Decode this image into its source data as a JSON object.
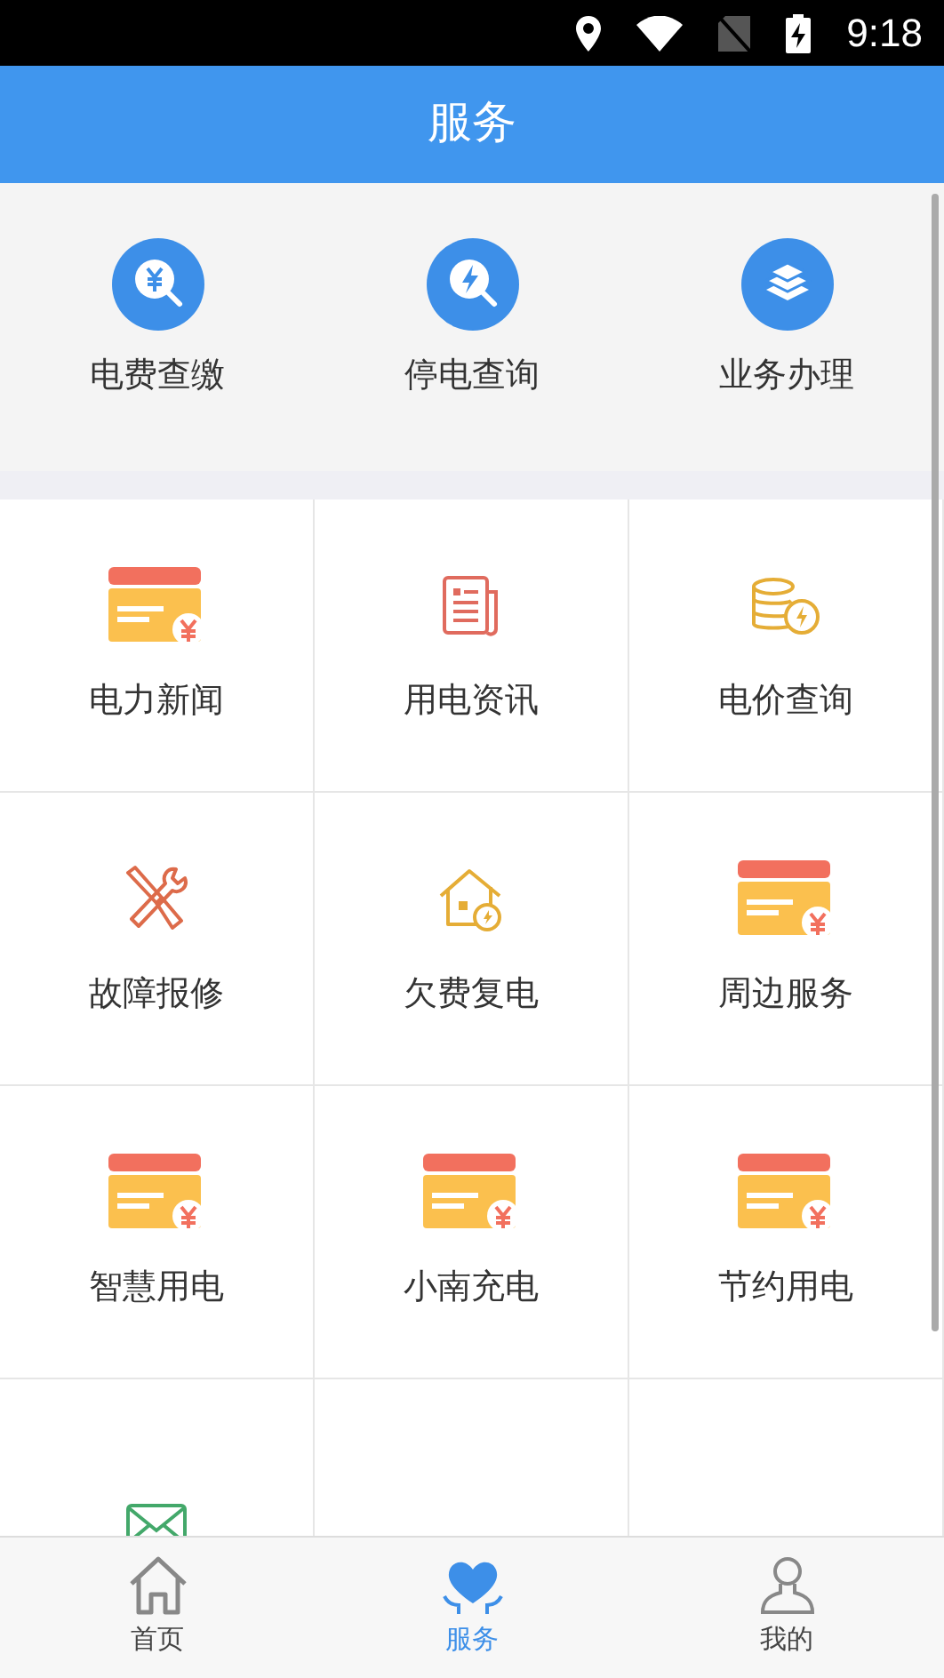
{
  "status_bar": {
    "time": "9:18"
  },
  "header": {
    "title": "服务"
  },
  "top_services": [
    {
      "label": "电费查缴",
      "kind": "yen_search"
    },
    {
      "label": "停电查询",
      "kind": "bolt_search"
    },
    {
      "label": "业务办理",
      "kind": "layers"
    }
  ],
  "grid": [
    {
      "label": "电力新闻",
      "kind": "card"
    },
    {
      "label": "用电资讯",
      "kind": "document"
    },
    {
      "label": "电价查询",
      "kind": "coins"
    },
    {
      "label": "故障报修",
      "kind": "tools"
    },
    {
      "label": "欠费复电",
      "kind": "house"
    },
    {
      "label": "周边服务",
      "kind": "card"
    },
    {
      "label": "智慧用电",
      "kind": "card"
    },
    {
      "label": "小南充电",
      "kind": "card"
    },
    {
      "label": "节约用电",
      "kind": "card"
    },
    {
      "kind": "envelope"
    },
    {
      "kind": "empty"
    },
    {
      "kind": "empty"
    }
  ],
  "bottom_nav": [
    {
      "label": "首页",
      "kind": "home",
      "selected": false
    },
    {
      "label": "服务",
      "kind": "heart",
      "selected": true
    },
    {
      "label": "我的",
      "kind": "person",
      "selected": false
    }
  ]
}
